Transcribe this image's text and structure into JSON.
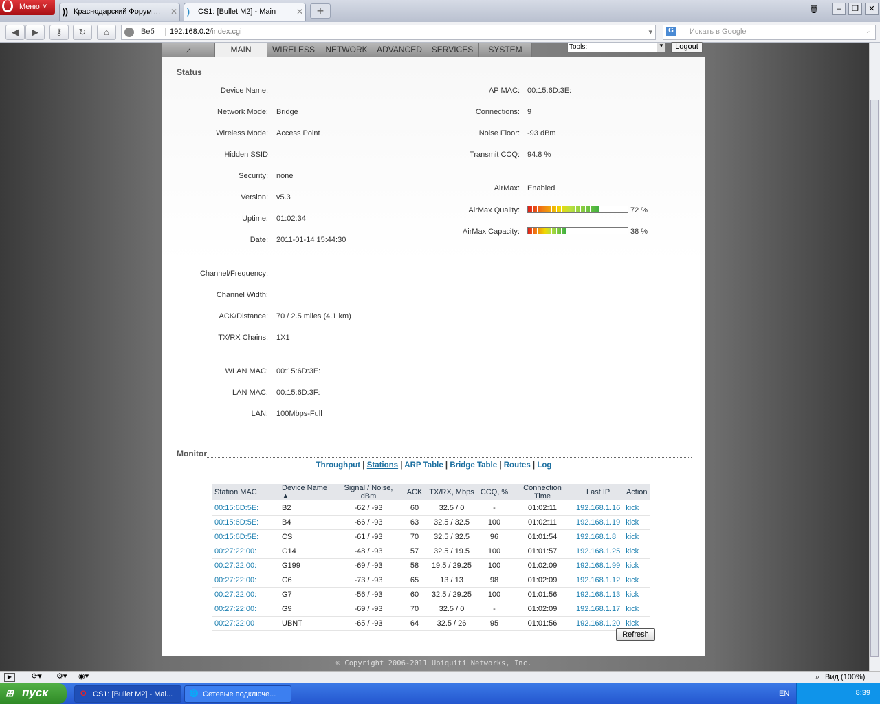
{
  "browser": {
    "menu": "Меню",
    "tabs": [
      {
        "title": "Краснодарский Форум ...",
        "active": false
      },
      {
        "title": "CS1: [Bullet M2] - Main",
        "active": true
      }
    ],
    "web_label": "Веб",
    "url_host": "192.168.0.2",
    "url_path": "/index.cgi",
    "search_placeholder": "Искать в Google",
    "zoom": "Вид (100%)"
  },
  "nav": {
    "tabs": [
      "MAIN",
      "WIRELESS",
      "NETWORK",
      "ADVANCED",
      "SERVICES",
      "SYSTEM"
    ],
    "tools": "Tools:",
    "logout": "Logout"
  },
  "status": {
    "title": "Status",
    "left": [
      {
        "label": "Device Name:",
        "value": ""
      },
      {
        "label": "Network Mode:",
        "value": "Bridge"
      },
      {
        "label": "Wireless Mode:",
        "value": "Access Point"
      },
      {
        "label": "Hidden SSID",
        "value": ""
      },
      {
        "label": "Security:",
        "value": "none"
      },
      {
        "label": "Version:",
        "value": "v5.3"
      },
      {
        "label": "Uptime:",
        "value": "01:02:34"
      },
      {
        "label": "Date:",
        "value": "2011-01-14 15:44:30"
      },
      {
        "label": "Channel/Frequency:",
        "value": ""
      },
      {
        "label": "Channel Width:",
        "value": ""
      },
      {
        "label": "ACK/Distance:",
        "value": "70 / 2.5 miles (4.1 km)"
      },
      {
        "label": "TX/RX Chains:",
        "value": "1X1"
      },
      {
        "label": "WLAN MAC:",
        "value": "00:15:6D:3E:"
      },
      {
        "label": "LAN MAC:",
        "value": "00:15:6D:3F:"
      },
      {
        "label": "LAN:",
        "value": "100Mbps-Full"
      }
    ],
    "right": [
      {
        "label": "AP MAC:",
        "value": "00:15:6D:3E:"
      },
      {
        "label": "Connections:",
        "value": "9"
      },
      {
        "label": "Noise Floor:",
        "value": "-93 dBm"
      },
      {
        "label": "Transmit CCQ:",
        "value": "94.8 %"
      },
      {
        "label": "AirMax:",
        "value": "Enabled"
      }
    ],
    "airmax_quality": {
      "label": "AirMax Quality:",
      "percent": 72,
      "text": "72 %"
    },
    "airmax_capacity": {
      "label": "AirMax Capacity:",
      "percent": 38,
      "text": "38 %"
    }
  },
  "monitor": {
    "title": "Monitor",
    "links": [
      "Throughput",
      "Stations",
      "ARP Table",
      "Bridge Table",
      "Routes",
      "Log"
    ],
    "columns": [
      "Station MAC",
      "Device Name ▲",
      "Signal / Noise, dBm",
      "ACK",
      "TX/RX, Mbps",
      "CCQ, %",
      "Connection Time",
      "Last IP",
      "Action"
    ],
    "rows": [
      [
        "00:15:6D:5E:",
        "B2",
        "-62 / -93",
        "60",
        "32.5 / 0",
        "-",
        "01:02:11",
        "192.168.1.16",
        "kick"
      ],
      [
        "00:15:6D:5E:",
        "B4",
        "-66 / -93",
        "63",
        "32.5 / 32.5",
        "100",
        "01:02:11",
        "192.168.1.19",
        "kick"
      ],
      [
        "00:15:6D:5E:",
        "CS",
        "-61 / -93",
        "70",
        "32.5 / 32.5",
        "96",
        "01:01:54",
        "192.168.1.8",
        "kick"
      ],
      [
        "00:27:22:00:",
        "G14",
        "-48 / -93",
        "57",
        "32.5 / 19.5",
        "100",
        "01:01:57",
        "192.168.1.25",
        "kick"
      ],
      [
        "00:27:22:00:",
        "G199",
        "-69 / -93",
        "58",
        "19.5 / 29.25",
        "100",
        "01:02:09",
        "192.168.1.99",
        "kick"
      ],
      [
        "00:27:22:00:",
        "G6",
        "-73 / -93",
        "65",
        "13 / 13",
        "98",
        "01:02:09",
        "192.168.1.12",
        "kick"
      ],
      [
        "00:27:22:00:",
        "G7",
        "-56 / -93",
        "60",
        "32.5 / 29.25",
        "100",
        "01:01:56",
        "192.168.1.13",
        "kick"
      ],
      [
        "00:27:22:00:",
        "G9",
        "-69 / -93",
        "70",
        "32.5 / 0",
        "-",
        "01:02:09",
        "192.168.1.17",
        "kick"
      ],
      [
        "00:27:22:00",
        "UBNT",
        "-65 / -93",
        "64",
        "32.5 / 26",
        "95",
        "01:01:56",
        "192.168.1.20",
        "kick"
      ]
    ],
    "refresh": "Refresh"
  },
  "footer": "© Copyright 2006-2011 Ubiquiti Networks, Inc.",
  "taskbar": {
    "start": "пуск",
    "items": [
      "CS1: [Bullet M2] - Mai...",
      "Сетевые подключе..."
    ],
    "lang": "EN",
    "time": "8:39"
  }
}
